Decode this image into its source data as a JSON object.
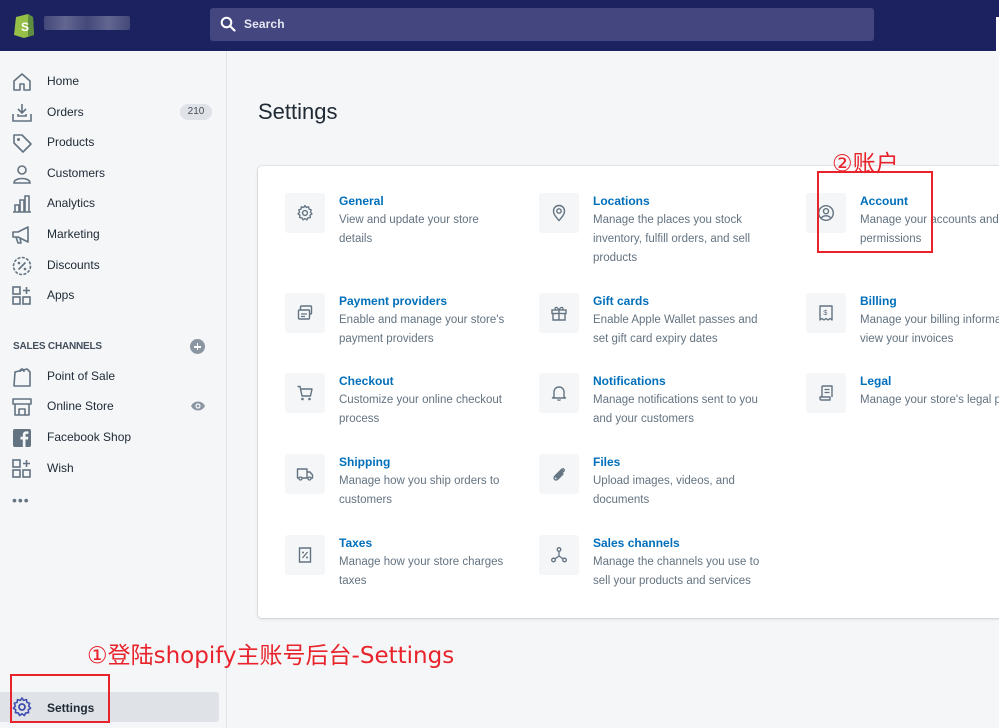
{
  "search": {
    "placeholder": "Search"
  },
  "sidebar": {
    "items": [
      {
        "label": "Home",
        "icon": "home-icon"
      },
      {
        "label": "Orders",
        "icon": "orders-icon",
        "badge": "210"
      },
      {
        "label": "Products",
        "icon": "tag-icon"
      },
      {
        "label": "Customers",
        "icon": "person-icon"
      },
      {
        "label": "Analytics",
        "icon": "bar-chart-icon"
      },
      {
        "label": "Marketing",
        "icon": "megaphone-icon"
      },
      {
        "label": "Discounts",
        "icon": "discount-icon"
      },
      {
        "label": "Apps",
        "icon": "apps-icon"
      }
    ],
    "sales_channels_heading": "SALES CHANNELS",
    "channels": [
      {
        "label": "Point of Sale",
        "icon": "pos-icon"
      },
      {
        "label": "Online Store",
        "icon": "store-icon"
      },
      {
        "label": "Facebook Shop",
        "icon": "facebook-icon"
      },
      {
        "label": "Wish",
        "icon": "wish-icon"
      }
    ],
    "settings_label": "Settings"
  },
  "main": {
    "title": "Settings",
    "tiles": [
      {
        "title": "General",
        "desc": "View and update your store details",
        "icon": "gear-icon"
      },
      {
        "title": "Locations",
        "desc": "Manage the places you stock inventory, fulfill orders, and sell products",
        "icon": "location-pin-icon"
      },
      {
        "title": "Account",
        "desc": "Manage your accounts and permissions",
        "icon": "account-icon"
      },
      {
        "title": "Payment providers",
        "desc": "Enable and manage your store's payment providers",
        "icon": "payment-icon"
      },
      {
        "title": "Gift cards",
        "desc": "Enable Apple Wallet passes and set gift card expiry dates",
        "icon": "gift-icon"
      },
      {
        "title": "Billing",
        "desc": "Manage your billing informa and view your invoices",
        "icon": "billing-icon"
      },
      {
        "title": "Checkout",
        "desc": "Customize your online checkout process",
        "icon": "cart-icon"
      },
      {
        "title": "Notifications",
        "desc": "Manage notifications sent to you and your customers",
        "icon": "bell-icon"
      },
      {
        "title": "Legal",
        "desc": "Manage your store's legal pa",
        "icon": "legal-icon"
      },
      {
        "title": "Shipping",
        "desc": "Manage how you ship orders to customers",
        "icon": "truck-icon"
      },
      {
        "title": "Files",
        "desc": "Upload images, videos, and documents",
        "icon": "paperclip-icon"
      },
      {
        "title": "Taxes",
        "desc": "Manage how your store charges taxes",
        "icon": "tax-icon"
      },
      {
        "title": "Sales channels",
        "desc": "Manage the channels you use to sell your products and services",
        "icon": "channels-icon"
      }
    ]
  },
  "annotations": {
    "step1": "①登陆shopify主账号后台-Settings",
    "step2": "②账户",
    "color": "#e8232b"
  }
}
